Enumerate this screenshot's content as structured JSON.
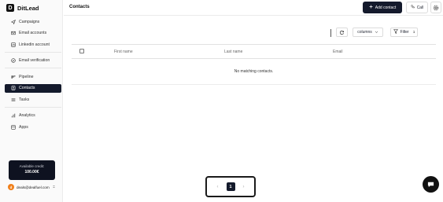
{
  "brand": {
    "logo_letter": "D",
    "name": "DitLead"
  },
  "sidebar": {
    "items": [
      {
        "label": "Campaigns",
        "icon": "send-icon"
      },
      {
        "label": "Email accounts",
        "icon": "mail-icon"
      },
      {
        "label": "Linkedin account",
        "icon": "linkedin-icon"
      },
      {
        "label": "Email verification",
        "icon": "check-circle-icon"
      },
      {
        "label": "Pipeline",
        "icon": "pipeline-icon"
      },
      {
        "label": "Contacts",
        "icon": "contacts-icon",
        "active": true
      },
      {
        "label": "Tasks",
        "icon": "tasks-icon"
      },
      {
        "label": "Analytics",
        "icon": "bar-chart-icon"
      },
      {
        "label": "Apps",
        "icon": "apps-icon"
      }
    ],
    "credits": {
      "label": "Available credit:",
      "value": "100.00€"
    },
    "user": {
      "initial": "d",
      "email": "deals@dealfuel.com"
    }
  },
  "header": {
    "title": "Contacts",
    "add_contact_label": "Add contact",
    "call_label": "Call"
  },
  "toolbar": {
    "columns_label": "columns",
    "filter_label": "Filter",
    "filter_count": "1"
  },
  "table": {
    "columns": [
      "First name",
      "Last name",
      "Email"
    ],
    "empty_message": "No matching contacts."
  },
  "pagination": {
    "current_page": "1",
    "prev": "‹",
    "next": "›"
  },
  "colors": {
    "primary": "#141a2c",
    "avatar": "#f07f1a"
  }
}
